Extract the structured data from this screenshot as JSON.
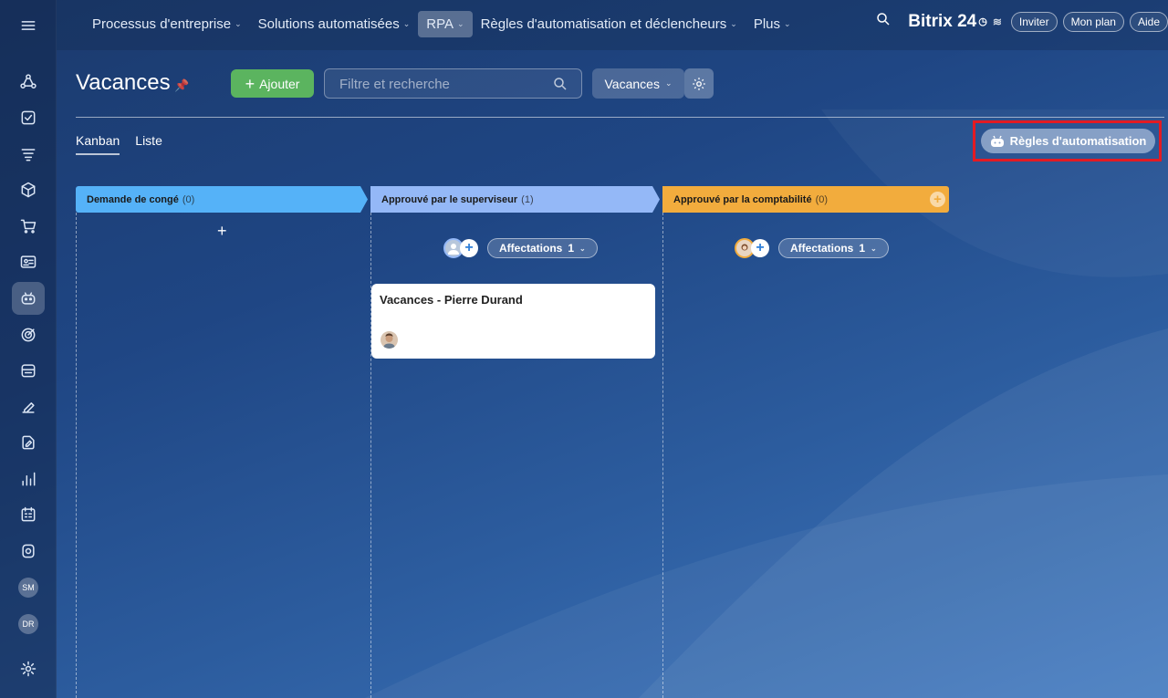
{
  "topnav": {
    "items": [
      {
        "label": "Processus d'entreprise",
        "has_chevron": true
      },
      {
        "label": "Solutions automatisées",
        "has_chevron": true
      },
      {
        "label": "RPA",
        "has_chevron": true,
        "active": true
      },
      {
        "label": "Règles d'automatisation et déclencheurs",
        "has_chevron": true
      },
      {
        "label": "Plus",
        "has_chevron": true
      }
    ],
    "logo": "Bitrix 24",
    "invite": "Inviter",
    "plan": "Mon plan",
    "help": "Aide"
  },
  "sidebar": {
    "avatars": [
      "SM",
      "DR"
    ]
  },
  "header": {
    "title": "Vacances",
    "add_label": "Ajouter",
    "search_placeholder": "Filtre et recherche",
    "view_label": "Vacances"
  },
  "tabs": {
    "kanban": "Kanban",
    "list": "Liste"
  },
  "automation_button": "Règles d'automatisation",
  "columns": [
    {
      "title": "Demande de congé",
      "count": "(0)",
      "color": "#55b2f8"
    },
    {
      "title": "Approuvé par le superviseur",
      "count": "(1)",
      "color": "#94b8f7",
      "assignments": "Affectations",
      "assign_count": "1"
    },
    {
      "title": "Approuvé par la comptabilité",
      "count": "(0)",
      "color": "#f2ac3d",
      "assignments": "Affectations",
      "assign_count": "1"
    }
  ],
  "card": {
    "title": "Vacances - Pierre Durand"
  }
}
